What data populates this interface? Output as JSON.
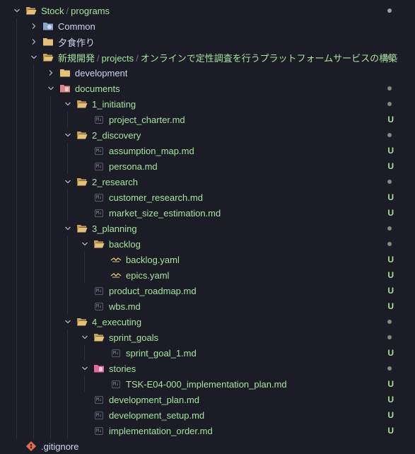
{
  "root": {
    "label": "Stock",
    "label2": "programs"
  },
  "common": {
    "label": "Common"
  },
  "yushoku": {
    "label": "夕食作り"
  },
  "project": {
    "label": "新規開発",
    "label2": "projects",
    "label3": "オンラインで定性調査を行うプラットフォームサービスの構築"
  },
  "development": {
    "label": "development"
  },
  "documents": {
    "label": "documents"
  },
  "initiating": {
    "label": "1_initiating",
    "files": [
      {
        "label": "project_charter.md",
        "status": "U"
      }
    ]
  },
  "discovery": {
    "label": "2_discovery",
    "files": [
      {
        "label": "assumption_map.md",
        "status": "U"
      },
      {
        "label": "persona.md",
        "status": "U"
      }
    ]
  },
  "research": {
    "label": "2_research",
    "files": [
      {
        "label": "customer_research.md",
        "status": "U"
      },
      {
        "label": "market_size_estimation.md",
        "status": "U"
      }
    ]
  },
  "planning": {
    "label": "3_planning",
    "backlog": {
      "label": "backlog",
      "files": [
        {
          "label": "backlog.yaml",
          "status": "U"
        },
        {
          "label": "epics.yaml",
          "status": "U"
        }
      ]
    },
    "files": [
      {
        "label": "product_roadmap.md",
        "status": "U"
      },
      {
        "label": "wbs.md",
        "status": "U"
      }
    ]
  },
  "executing": {
    "label": "4_executing",
    "sprint_goals": {
      "label": "sprint_goals",
      "files": [
        {
          "label": "sprint_goal_1.md",
          "status": "U"
        }
      ]
    },
    "stories": {
      "label": "stories",
      "files": [
        {
          "label": "TSK-E04-000_implementation_plan.md",
          "status": "U"
        }
      ]
    },
    "files": [
      {
        "label": "development_plan.md",
        "status": "U"
      },
      {
        "label": "development_setup.md",
        "status": "U"
      },
      {
        "label": "implementation_order.md",
        "status": "U"
      }
    ]
  },
  "gitignore": {
    "label": ".gitignore"
  },
  "badges": {
    "md": "M↓"
  },
  "colors": {
    "background": "#1b1c26",
    "untracked_text": "#a6e3a1",
    "folder": "#e5c07b",
    "status_dot": "#7f8a7c"
  }
}
